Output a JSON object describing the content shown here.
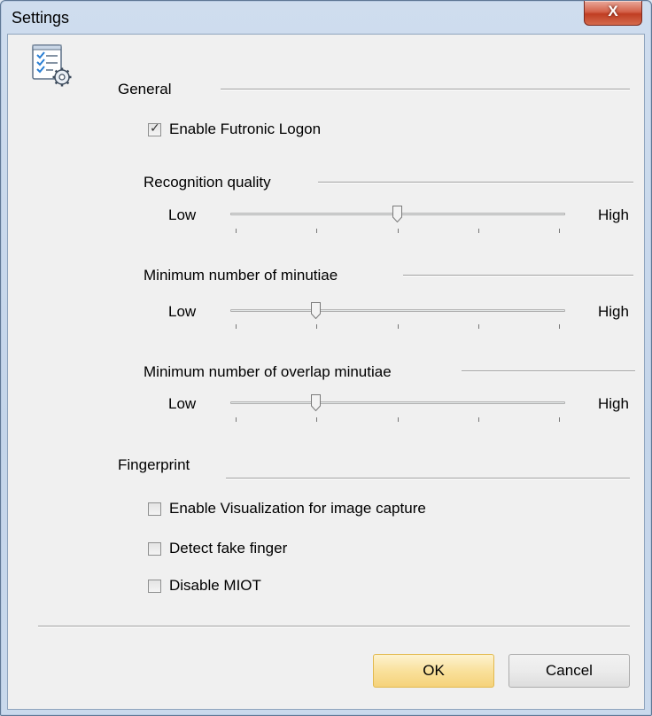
{
  "window": {
    "title": "Settings",
    "close_glyph": "X"
  },
  "general": {
    "label": "General",
    "enable_logon": {
      "label": "Enable Futronic Logon",
      "checked": true
    },
    "sliders": [
      {
        "label": "Recognition quality",
        "low": "Low",
        "high": "High",
        "value_fraction": 0.5
      },
      {
        "label": "Minimum number of minutiae",
        "low": "Low",
        "high": "High",
        "value_fraction": 0.25
      },
      {
        "label": "Minimum number of overlap minutiae",
        "low": "Low",
        "high": "High",
        "value_fraction": 0.25
      }
    ]
  },
  "fingerprint": {
    "label": "Fingerprint",
    "options": [
      {
        "label": "Enable Visualization for image capture",
        "checked": false
      },
      {
        "label": "Detect fake finger",
        "checked": false
      },
      {
        "label": "Disable MIOT",
        "checked": false
      }
    ]
  },
  "buttons": {
    "ok": "OK",
    "cancel": "Cancel"
  },
  "icons": {
    "settings": "checklist-gear-icon",
    "close": "close-icon"
  },
  "colors": {
    "close_button": "#c8452b",
    "ok_button": "#f9e19c",
    "window_frame": "#c4d5ea"
  }
}
